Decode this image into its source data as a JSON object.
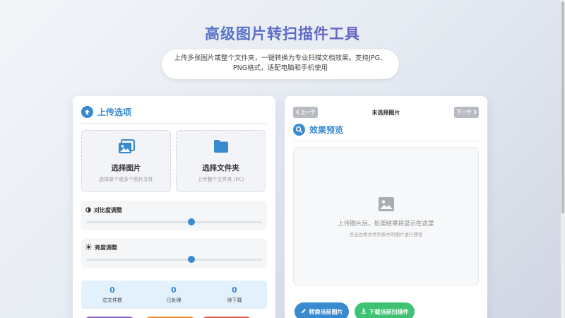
{
  "header": {
    "title": "高级图片转扫描件工具",
    "subtitle": "上传多张图片或整个文件夹，一键转换为专业扫描文档效果。支持JPG、PNG格式，适配电脑和手机使用"
  },
  "upload": {
    "title": "上传选项",
    "choose_images": {
      "label": "选择图片",
      "hint": "选择单个或多个图片文件",
      "icon": "images-icon"
    },
    "choose_folder": {
      "label": "选择文件夹",
      "hint": "上传整个文件夹 (PC)",
      "icon": "folder-icon"
    }
  },
  "adjustments": {
    "contrast": {
      "label": "对比度调整",
      "value": 0.6
    },
    "brightness": {
      "label": "亮度调整",
      "value": 0.6
    }
  },
  "stats": [
    {
      "value": "0",
      "label": "总文件数"
    },
    {
      "value": "0",
      "label": "已处理"
    },
    {
      "value": "0",
      "label": "待下载"
    }
  ],
  "preview": {
    "prev_label": "上一个",
    "next_label": "下一个",
    "status": "未选择图片",
    "title": "效果预览",
    "empty_main": "上传图片后，处理结果将显示在这里",
    "empty_sub": "点击左侧文件列表中的图片进行预览"
  },
  "actions": {
    "convert_label": "转换当前图片",
    "download_label": "下载当前扫描件"
  },
  "colors": {
    "accent": "#3a8ad0",
    "convert": "#3a8ad0",
    "download": "#3fc372",
    "tab_purple": "#8e5cc5",
    "tab_orange": "#ef8a2a",
    "tab_red": "#e4574c"
  }
}
